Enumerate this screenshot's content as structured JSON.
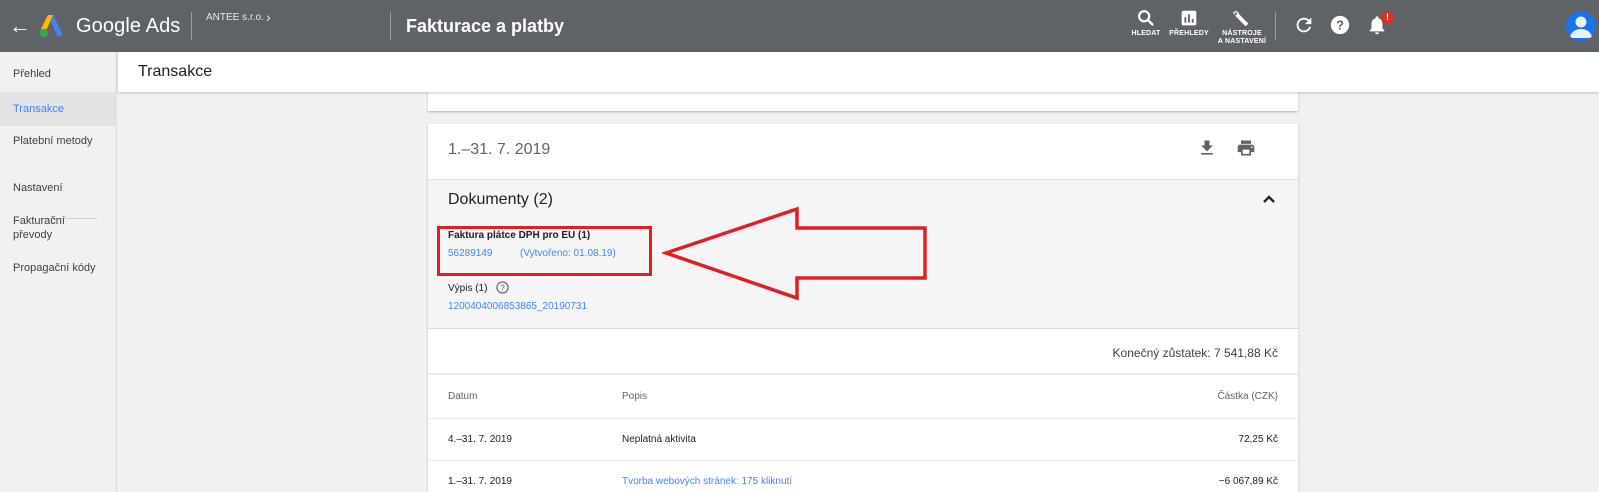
{
  "header": {
    "back_label": "←",
    "brand": "Google Ads",
    "account": "ANTEE s.r.o.",
    "account_chevron": "›",
    "page_title": "Fakturace a platby",
    "tools": [
      {
        "label_line1": "HLEDAT",
        "label_line2": "",
        "icon": "search-icon"
      },
      {
        "label_line1": "PŘEHLEDY",
        "label_line2": "",
        "icon": "reports-icon"
      },
      {
        "label_line1": "NÁSTROJE",
        "label_line2": "A NASTAVENÍ",
        "icon": "wrench-icon"
      }
    ],
    "notification_badge": "!"
  },
  "sidebar": {
    "items": [
      {
        "label": "Přehled",
        "active": false
      },
      {
        "label": "Transakce",
        "active": true
      },
      {
        "label": "Platební metody",
        "active": false
      },
      {
        "label": "Nastavení",
        "active": false
      },
      {
        "label": "Fakturační převody",
        "active": false
      },
      {
        "label": "Propagační kódy",
        "active": false
      }
    ]
  },
  "subheader": {
    "title": "Transakce"
  },
  "statement": {
    "period": "1.–31. 7. 2019",
    "documents": {
      "title": "Dokumenty (2)",
      "invoice_label": "Faktura plátce DPH pro EU (1)",
      "invoice_number": "56289149",
      "invoice_created": "(Vytvořeno: 01.08.19)",
      "statement_label": "Výpis (1)",
      "statement_number": "1200404006853865_20190731"
    },
    "ending_balance": "Konečný zůstatek: 7 541,88 Kč",
    "table": {
      "headers": {
        "date": "Datum",
        "description": "Popis",
        "amount": "Částka (CZK)"
      },
      "rows": [
        {
          "date": "4.–31. 7. 2019",
          "description": "Neplatná aktivita",
          "amount": "72,25 Kč"
        },
        {
          "date": "1.–31. 7. 2019",
          "description": "Tvorba webových stránek: 175 kliknutí",
          "amount": "−6 067,89 Kč"
        }
      ]
    }
  },
  "colors": {
    "topbar": "#5f6368",
    "accent_link": "#4285f4",
    "annotation_red": "#e01e26",
    "notification_red": "#d93025"
  }
}
